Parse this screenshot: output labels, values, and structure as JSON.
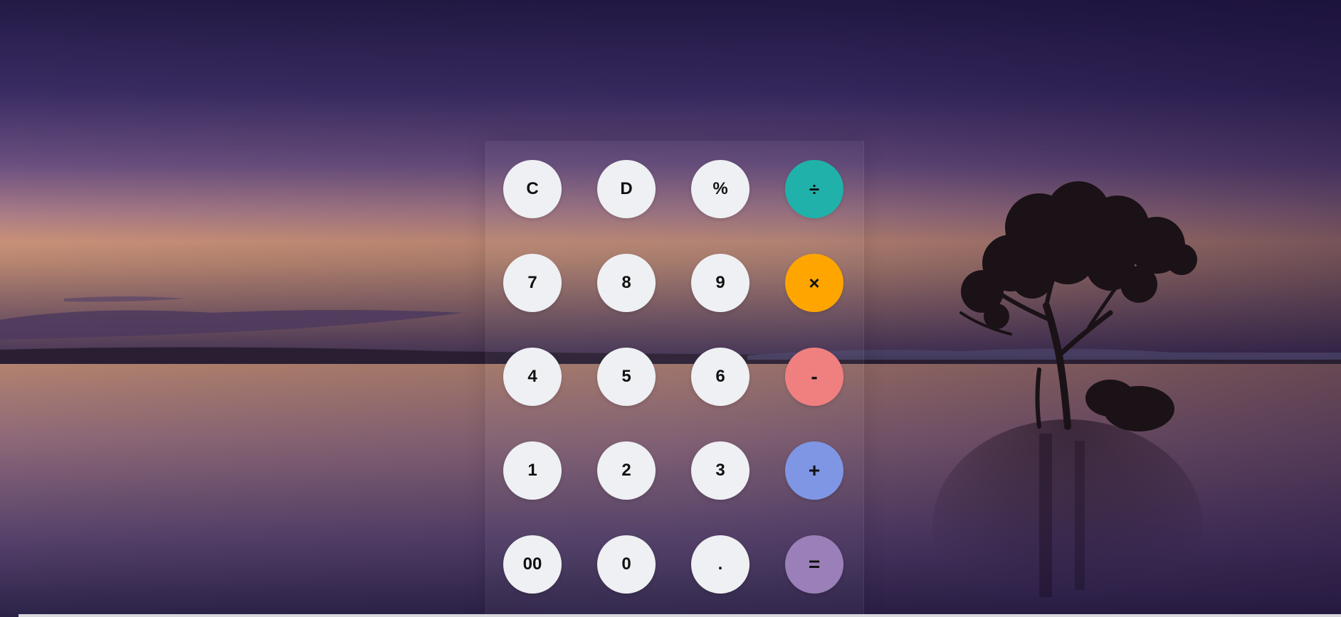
{
  "calculator": {
    "keys": [
      {
        "label": "C",
        "name": "clear-button",
        "color": "#eef0f3"
      },
      {
        "label": "D",
        "name": "delete-button",
        "color": "#eef0f3"
      },
      {
        "label": "%",
        "name": "percent-button",
        "color": "#eef0f3"
      },
      {
        "label": "÷",
        "name": "divide-button",
        "color": "#20b2aa"
      },
      {
        "label": "7",
        "name": "digit-7-button",
        "color": "#eef0f3"
      },
      {
        "label": "8",
        "name": "digit-8-button",
        "color": "#eef0f3"
      },
      {
        "label": "9",
        "name": "digit-9-button",
        "color": "#eef0f3"
      },
      {
        "label": "×",
        "name": "multiply-button",
        "color": "#ffa500"
      },
      {
        "label": "4",
        "name": "digit-4-button",
        "color": "#eef0f3"
      },
      {
        "label": "5",
        "name": "digit-5-button",
        "color": "#eef0f3"
      },
      {
        "label": "6",
        "name": "digit-6-button",
        "color": "#eef0f3"
      },
      {
        "label": "-",
        "name": "subtract-button",
        "color": "#f08080"
      },
      {
        "label": "1",
        "name": "digit-1-button",
        "color": "#eef0f3"
      },
      {
        "label": "2",
        "name": "digit-2-button",
        "color": "#eef0f3"
      },
      {
        "label": "3",
        "name": "digit-3-button",
        "color": "#eef0f3"
      },
      {
        "label": "+",
        "name": "add-button",
        "color": "#7f96e4"
      },
      {
        "label": "00",
        "name": "double-zero-button",
        "color": "#eef0f3"
      },
      {
        "label": "0",
        "name": "digit-0-button",
        "color": "#eef0f3"
      },
      {
        "label": ".",
        "name": "decimal-button",
        "color": "#eef0f3"
      },
      {
        "label": "=",
        "name": "equals-button",
        "color": "#9a7fb8"
      }
    ]
  },
  "theme": {
    "key_default": "#eef0f3",
    "key_text": "#111111",
    "background_sky_top": "#221a45",
    "background_horizon": "#c78a72"
  }
}
